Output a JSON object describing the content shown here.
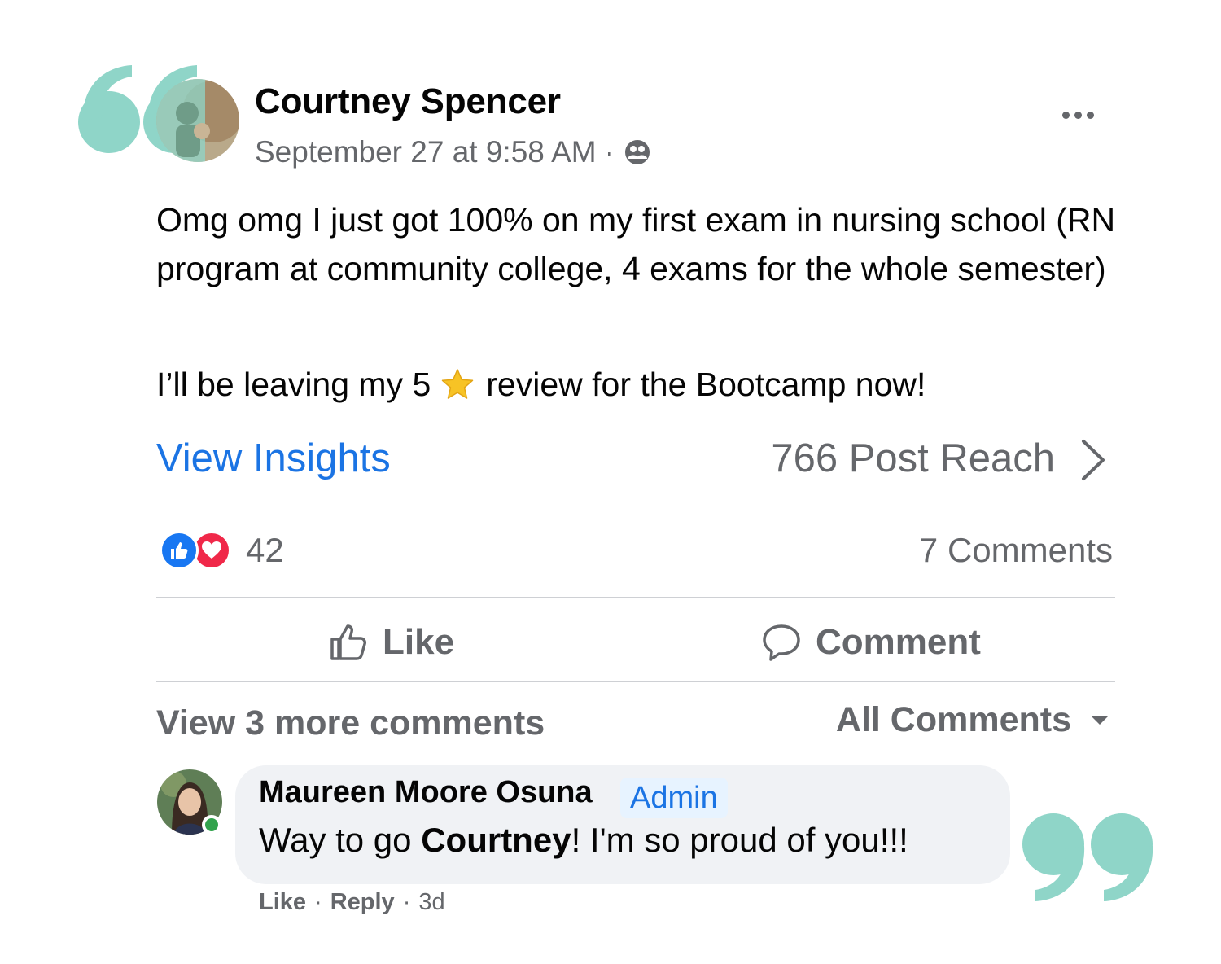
{
  "colors": {
    "quote_mark": "#8fd5c8",
    "link_blue": "#1b74e4",
    "secondary_text": "#65676b",
    "like_blue": "#1877f2",
    "love_red": "#f02849",
    "online_green": "#31a24c"
  },
  "post": {
    "author": "Courtney Spencer",
    "timestamp": "September 27 at 9:58 AM",
    "separator": "·",
    "audience_icon": "group-audience-icon",
    "body_line1": "Omg omg I just got 100% on my first exam in nursing school (RN program at community college, 4 exams for the whole semester)",
    "body_line2_before": "I’ll be leaving my 5",
    "body_line2_after": "review for the Bootcamp now!",
    "emoji_icon": "star-icon"
  },
  "insights": {
    "link_label": "View Insights",
    "reach_label": "766 Post Reach"
  },
  "reactions": {
    "types": [
      "like",
      "love"
    ],
    "count": "42",
    "comments_count": "7 Comments"
  },
  "actions": {
    "like_label": "Like",
    "comment_label": "Comment"
  },
  "comments_section": {
    "view_more": "View 3 more comments",
    "filter_label": "All Comments"
  },
  "comment": {
    "author": "Maureen Moore Osuna",
    "badge": "Admin",
    "text_before": "Way to go ",
    "text_mention": "Courtney",
    "text_after": "! I'm so proud of you!!!",
    "like_label": "Like",
    "reply_label": "Reply",
    "dot": "·",
    "age": "3d"
  }
}
